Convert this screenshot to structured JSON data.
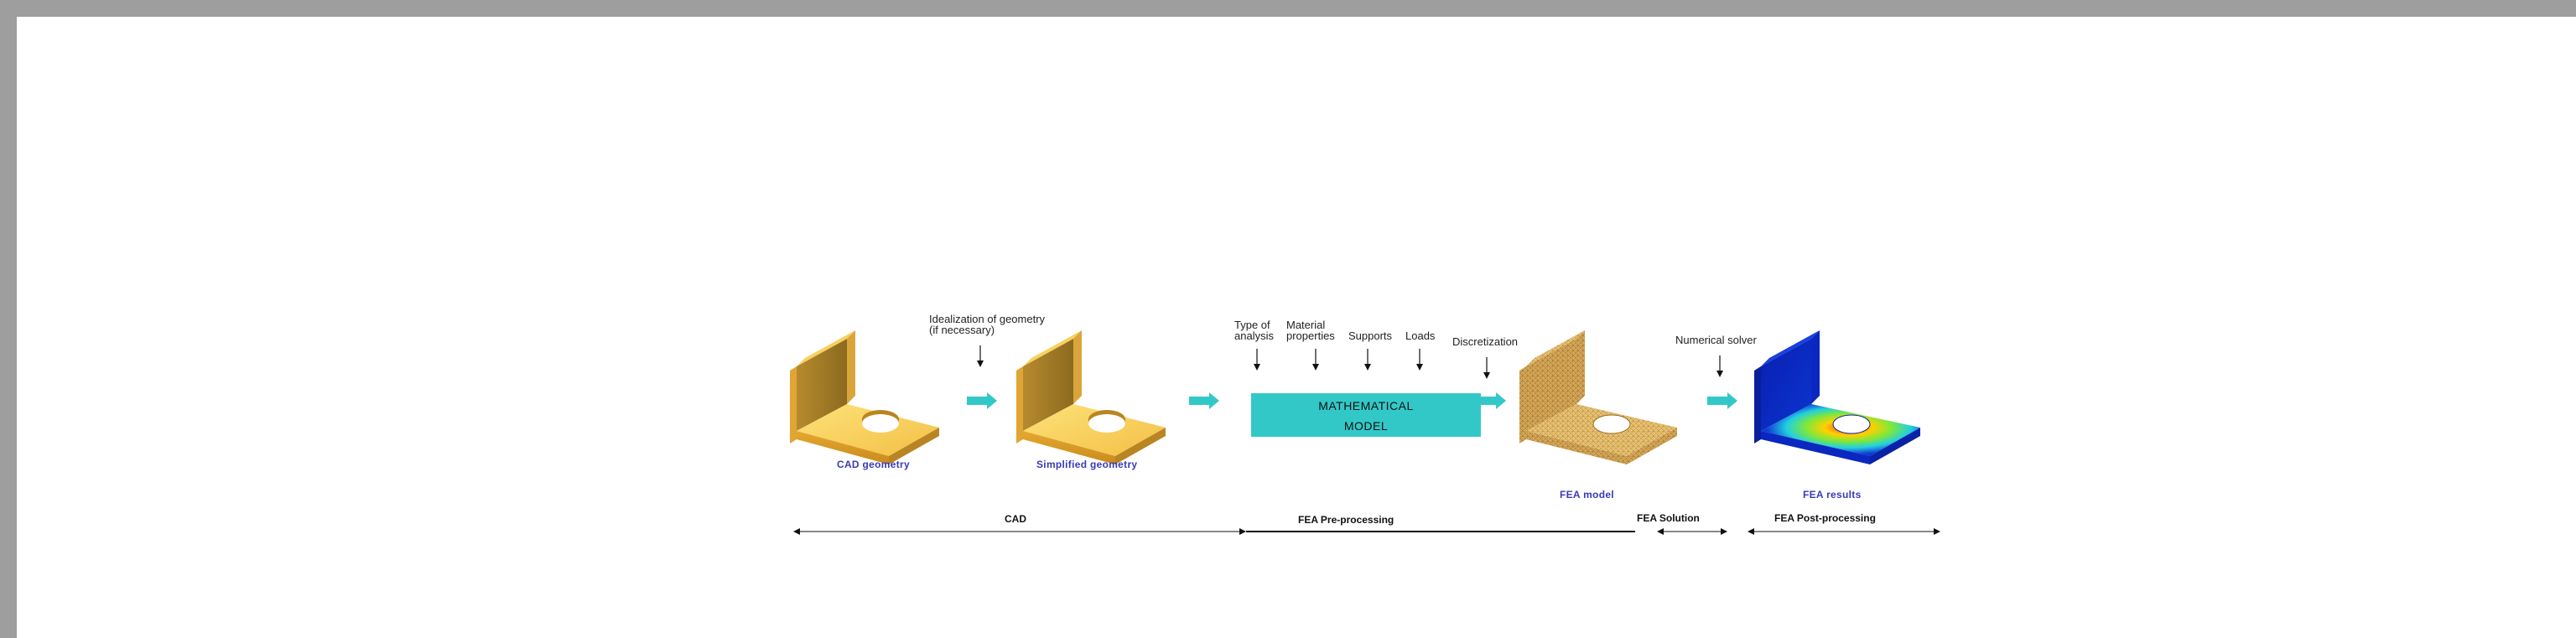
{
  "steps": {
    "idealization": [
      "Idealization of geometry",
      "(if necessary)"
    ],
    "type_of_analysis": [
      "Type of",
      "analysis"
    ],
    "material_properties": [
      "Material",
      "properties"
    ],
    "supports": "Supports",
    "loads": "Loads",
    "discretization": "Discretization",
    "numerical_solver": "Numerical solver"
  },
  "math_model": [
    "MATHEMATICAL",
    "MODEL"
  ],
  "captions": {
    "cad_geometry": "CAD geometry",
    "simplified_geometry": "Simplified geometry",
    "fea_model": "FEA model",
    "fea_results": "FEA results"
  },
  "phases": {
    "cad": "CAD",
    "pre_processing": "FEA Pre-processing",
    "solution": "FEA Solution",
    "post_processing": "FEA Post-processing"
  },
  "colors": {
    "process_arrow": "#33c8c8",
    "caption_text": "#3a3ab8",
    "part_yellow": "#f2c24e",
    "mesh_tan": "#e6c27a"
  },
  "icons": [
    "process-arrow-icon",
    "down-arrow-icon",
    "bracket-part-icon",
    "meshed-part-icon",
    "stress-result-icon"
  ]
}
